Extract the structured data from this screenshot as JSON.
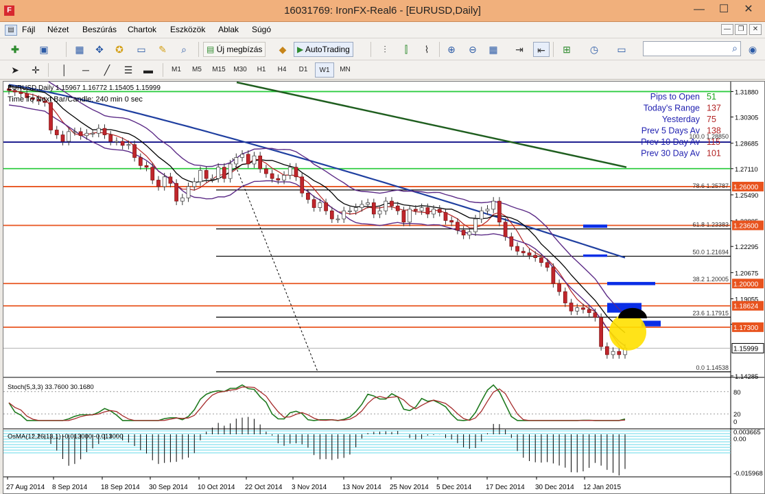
{
  "window": {
    "title": "16031769: IronFX-Real6 - [EURUSD,Daily]",
    "logo": "F"
  },
  "menu": {
    "items": [
      "Fájl",
      "Nézet",
      "Beszúrás",
      "Chartok",
      "Eszközök",
      "Ablak",
      "Súgó"
    ]
  },
  "toolbar": {
    "new_order": "Új megbízás",
    "autotrading": "AutoTrading"
  },
  "timeframes": [
    "M1",
    "M5",
    "M15",
    "M30",
    "H1",
    "H4",
    "D1",
    "W1",
    "MN"
  ],
  "chart": {
    "symbol_line": "EURUSD,Daily  1.15967 1.16772 1.15405 1.15999",
    "candle_timer": "Time To Next Bar/Candle: 240 min 0 sec",
    "price_labels": [
      "1.31880",
      "1.30305",
      "1.28685",
      "1.27110",
      "1.25490",
      "1.23885",
      "1.22295",
      "1.20675",
      "1.19055",
      "1.17480",
      "1.15999",
      "1.14285"
    ],
    "current_price": "1.15999",
    "level_tags": [
      {
        "text": "1.26000",
        "color": "#e8531e"
      },
      {
        "text": "1.23600",
        "color": "#e8531e"
      },
      {
        "text": "1.20000",
        "color": "#e8531e"
      },
      {
        "text": "1.18624",
        "color": "#e8531e"
      },
      {
        "text": "1.17300",
        "color": "#e8531e"
      }
    ],
    "fib_labels": [
      "100.0 1.28850",
      "78.6 1.25787",
      "61.8 1.23383",
      "50.0 1.21694",
      "38.2 1.20005",
      "23.6 1.17915",
      "0.0 1.14538"
    ],
    "info_panel": [
      {
        "label": "Pips to Open",
        "value": "51",
        "color": "#1aa21a"
      },
      {
        "label": "Today's Range",
        "value": "137",
        "color": "#b22222"
      },
      {
        "label": "Yesterday",
        "value": "75",
        "color": "#b22222"
      },
      {
        "label": "Prev 5 Days Av",
        "value": "138",
        "color": "#b22222"
      },
      {
        "label": "Prev 10 Day Av",
        "value": "115",
        "color": "#b22222"
      },
      {
        "label": "Prev 30 Day Av",
        "value": "101",
        "color": "#b22222"
      }
    ],
    "stoch": {
      "title": "Stoch(5,3,3) 33.7600 30.1680",
      "levels": [
        "80",
        "20",
        "0"
      ]
    },
    "osma": {
      "title": "OsMA(12,26,13,1) -0.013000 -0.013000",
      "scale": [
        "0.003665",
        "0.00",
        "-0.015968"
      ]
    },
    "dates": [
      "27 Aug 2014",
      "8 Sep 2014",
      "18 Sep 2014",
      "30 Sep 2014",
      "10 Oct 2014",
      "22 Oct 2014",
      "3 Nov 2014",
      "13 Nov 2014",
      "25 Nov 2014",
      "5 Dec 2014",
      "17 Dec 2014",
      "30 Dec 2014",
      "12 Jan 2015"
    ]
  },
  "chart_data": {
    "type": "candlestick",
    "symbol": "EURUSD",
    "timeframe": "Daily",
    "ylim": [
      1.1428,
      1.3245
    ],
    "closes": [
      1.3195,
      1.3185,
      1.3175,
      1.315,
      1.314,
      1.313,
      1.312,
      1.295,
      1.292,
      1.288,
      1.294,
      1.294,
      1.2915,
      1.293,
      1.293,
      1.296,
      1.292,
      1.288,
      1.288,
      1.2855,
      1.286,
      1.278,
      1.273,
      1.272,
      1.264,
      1.26,
      1.266,
      1.262,
      1.251,
      1.253,
      1.26,
      1.263,
      1.27,
      1.265,
      1.265,
      1.272,
      1.265,
      1.274,
      1.278,
      1.28,
      1.274,
      1.279,
      1.271,
      1.268,
      1.265,
      1.264,
      1.267,
      1.272,
      1.266,
      1.256,
      1.252,
      1.247,
      1.25,
      1.245,
      1.24,
      1.24,
      1.245,
      1.245,
      1.247,
      1.249,
      1.25,
      1.243,
      1.245,
      1.251,
      1.248,
      1.245,
      1.238,
      1.246,
      1.245,
      1.247,
      1.243,
      1.246,
      1.244,
      1.239,
      1.238,
      1.233,
      1.23,
      1.232,
      1.24,
      1.245,
      1.246,
      1.251,
      1.238,
      1.229,
      1.223,
      1.22,
      1.219,
      1.2175,
      1.216,
      1.213,
      1.21,
      1.2,
      1.195,
      1.188,
      1.183,
      1.185,
      1.184,
      1.182,
      1.179,
      1.161,
      1.156,
      1.158,
      1.156,
      1.16
    ],
    "stoch_levels": [
      80,
      20
    ],
    "horizontal_levels": [
      1.3188,
      1.2875,
      1.2711,
      1.26,
      1.236,
      1.2169,
      1.2,
      1.1862,
      1.1792,
      1.173,
      1.1454
    ]
  }
}
